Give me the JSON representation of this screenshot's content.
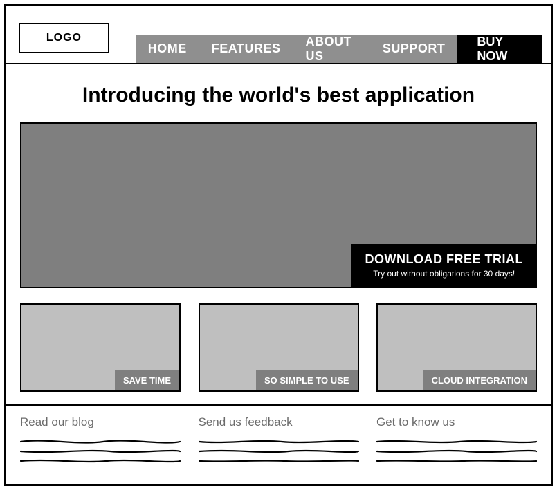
{
  "header": {
    "logo_text": "LOGO",
    "nav": [
      "HOME",
      "FEATURES",
      "ABOUT US",
      "SUPPORT"
    ],
    "cta": "BUY NOW"
  },
  "hero": {
    "headline": "Introducing the world's best application",
    "cta_title": "DOWNLOAD FREE TRIAL",
    "cta_sub": "Try out without obligations for 30 days!"
  },
  "features": [
    {
      "label": "SAVE TIME"
    },
    {
      "label": "SO SIMPLE TO USE"
    },
    {
      "label": "CLOUD INTEGRATION"
    }
  ],
  "footer": [
    {
      "heading": "Read our blog"
    },
    {
      "heading": "Send us feedback"
    },
    {
      "heading": "Get to know us"
    }
  ]
}
